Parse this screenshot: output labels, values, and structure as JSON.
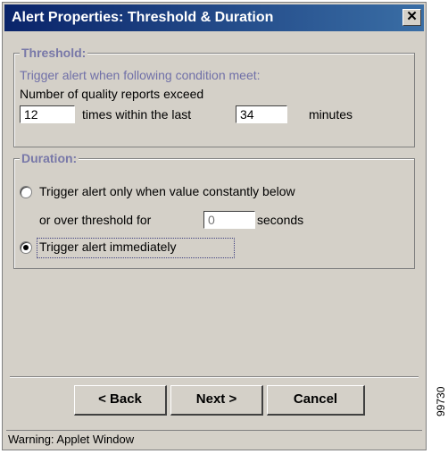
{
  "window": {
    "title": "Alert Properties: Threshold & Duration",
    "close_glyph": "✕"
  },
  "threshold": {
    "legend": "Threshold:",
    "description": "Trigger alert when following condition meet:",
    "line1": "Number of quality reports exceed",
    "count_value": "12",
    "middle_text": "times within the last",
    "minutes_value": "34",
    "minutes_label": "minutes"
  },
  "duration": {
    "legend": "Duration:",
    "option1_line1": "Trigger alert only when value constantly below",
    "option1_line2": "or over threshold for",
    "seconds_placeholder": "0",
    "seconds_label": "seconds",
    "option2_label": "Trigger alert immediately",
    "selected": "option2"
  },
  "buttons": {
    "back": "< Back",
    "next": "Next >",
    "cancel": "Cancel"
  },
  "status": {
    "text": "Warning: Applet Window"
  },
  "side_code": "99730"
}
